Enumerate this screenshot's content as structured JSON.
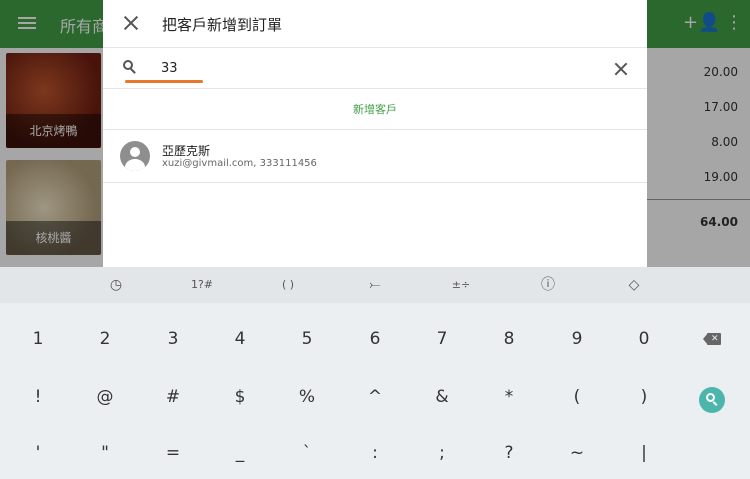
{
  "appbar": {
    "title": "所有商",
    "add_person_icon": "+👤",
    "more_icon": "⋮"
  },
  "products": [
    {
      "label": "北京烤鴨"
    },
    {
      "label": "核桃醬"
    }
  ],
  "order": {
    "prices": [
      "20.00",
      "17.00",
      "8.00",
      "19.00"
    ],
    "total": "64.00"
  },
  "dialog": {
    "title": "把客戶新增到訂單",
    "search_value": "33",
    "new_customer_label": "新增客戶",
    "customers": [
      {
        "name": "亞歷克斯",
        "detail": "xuzi@givmail.com, 333111456"
      }
    ]
  },
  "keyboard": {
    "toolbar": {
      "clock": "◷",
      "symbols": "1?#",
      "parens": "( )",
      "arrow": "⤚",
      "math": "±÷",
      "info": "ⓘ",
      "diamond": "◇"
    },
    "row1": [
      "1",
      "2",
      "3",
      "4",
      "5",
      "6",
      "7",
      "8",
      "9",
      "0"
    ],
    "row2": [
      "!",
      "@",
      "#",
      "$",
      "%",
      "^",
      "&",
      "*",
      "(",
      ")"
    ],
    "row3": [
      "'",
      "\"",
      "=",
      "_",
      "`",
      ":",
      ";",
      "?",
      "~",
      "|"
    ]
  }
}
